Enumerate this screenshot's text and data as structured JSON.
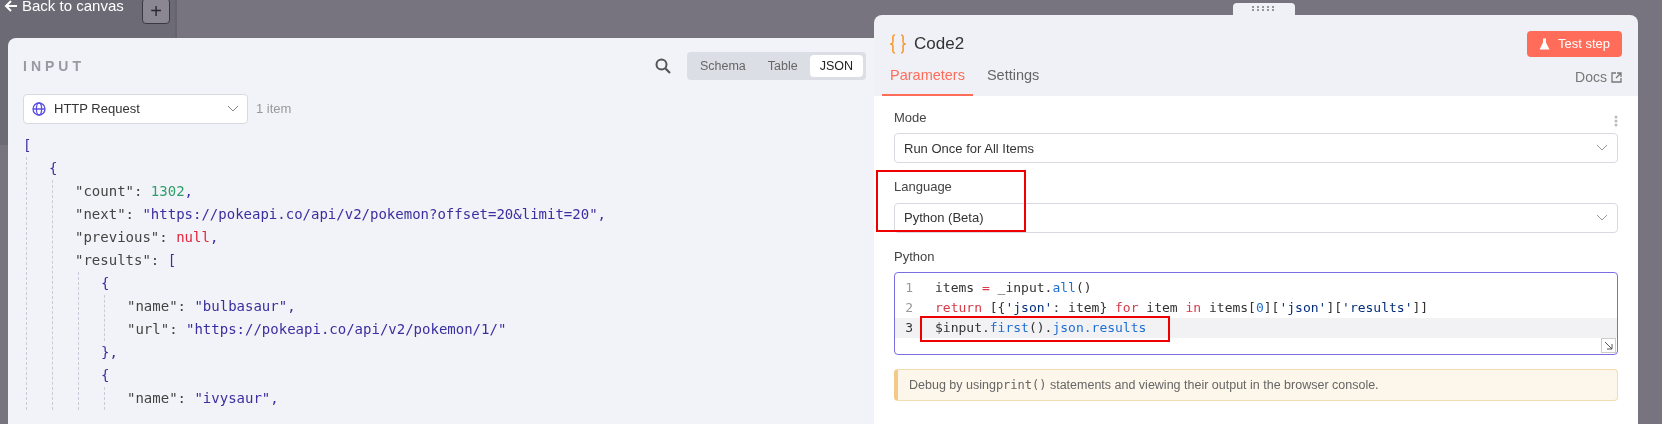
{
  "top_bar": {
    "back_link": "Back to canvas",
    "add_button": "+"
  },
  "input_panel": {
    "title": "INPUT",
    "view_tabs": [
      {
        "label": "Schema",
        "selected": false
      },
      {
        "label": "Table",
        "selected": false
      },
      {
        "label": "JSON",
        "selected": true
      }
    ],
    "source": {
      "value": "HTTP Request",
      "count": "1 item"
    },
    "json_lines": [
      {
        "tokens": [
          {
            "kind": "punct",
            "text": "["
          }
        ],
        "children": [
          {
            "tokens": [
              {
                "kind": "punct",
                "text": "{"
              }
            ],
            "children": [
              {
                "tokens": [
                  {
                    "kind": "key",
                    "text": "\"count\": "
                  },
                  {
                    "kind": "number",
                    "text": "1302"
                  },
                  {
                    "kind": "punct",
                    "text": ","
                  }
                ]
              },
              {
                "tokens": [
                  {
                    "kind": "key",
                    "text": "\"next\": "
                  },
                  {
                    "kind": "string",
                    "text": "\"https://pokeapi.co/api/v2/pokemon?offset=20&limit=20\""
                  },
                  {
                    "kind": "punct",
                    "text": ","
                  }
                ]
              },
              {
                "tokens": [
                  {
                    "kind": "key",
                    "text": "\"previous\": "
                  },
                  {
                    "kind": "null",
                    "text": "null"
                  },
                  {
                    "kind": "punct",
                    "text": ","
                  }
                ]
              },
              {
                "tokens": [
                  {
                    "kind": "key",
                    "text": "\"results\": "
                  },
                  {
                    "kind": "punct",
                    "text": "["
                  }
                ],
                "children": [
                  {
                    "tokens": [
                      {
                        "kind": "punct",
                        "text": "{"
                      }
                    ],
                    "children": [
                      {
                        "tokens": [
                          {
                            "kind": "key",
                            "text": "\"name\": "
                          },
                          {
                            "kind": "string",
                            "text": "\"bulbasaur\""
                          },
                          {
                            "kind": "punct",
                            "text": ","
                          }
                        ]
                      },
                      {
                        "tokens": [
                          {
                            "kind": "key",
                            "text": "\"url\": "
                          },
                          {
                            "kind": "string",
                            "text": "\"https://pokeapi.co/api/v2/pokemon/1/\""
                          }
                        ]
                      }
                    ]
                  },
                  {
                    "tokens": [
                      {
                        "kind": "punct",
                        "text": "},"
                      }
                    ]
                  },
                  {
                    "tokens": [
                      {
                        "kind": "punct",
                        "text": "{"
                      }
                    ],
                    "children": [
                      {
                        "tokens": [
                          {
                            "kind": "key",
                            "text": "\"name\": "
                          },
                          {
                            "kind": "string",
                            "text": "\"ivysaur\""
                          },
                          {
                            "kind": "punct",
                            "text": ","
                          }
                        ]
                      }
                    ]
                  }
                ]
              }
            ]
          }
        ]
      }
    ]
  },
  "node_panel": {
    "title": "Code2",
    "test_button": "Test step",
    "tabs": [
      {
        "label": "Parameters",
        "selected": true
      },
      {
        "label": "Settings",
        "selected": false
      }
    ],
    "docs_link": "Docs",
    "fields": [
      {
        "label": "Mode",
        "value": "Run Once for All Items",
        "highlighted": false
      },
      {
        "label": "Language",
        "value": "Python (Beta)",
        "highlighted": true
      }
    ],
    "code_label": "Python",
    "code_lines": [
      {
        "number": "1",
        "active": false,
        "highlighted": false,
        "tokens": [
          {
            "kind": "plain",
            "text": "items "
          },
          {
            "kind": "operator",
            "text": "="
          },
          {
            "kind": "plain",
            "text": " _input."
          },
          {
            "kind": "function",
            "text": "all"
          },
          {
            "kind": "plain",
            "text": "()"
          }
        ]
      },
      {
        "number": "2",
        "active": false,
        "highlighted": false,
        "tokens": [
          {
            "kind": "keyword",
            "text": "return"
          },
          {
            "kind": "plain",
            "text": " [{"
          },
          {
            "kind": "string",
            "text": "'json'"
          },
          {
            "kind": "plain",
            "text": ": item} "
          },
          {
            "kind": "keyword",
            "text": "for"
          },
          {
            "kind": "plain",
            "text": " item "
          },
          {
            "kind": "keyword",
            "text": "in"
          },
          {
            "kind": "plain",
            "text": " items["
          },
          {
            "kind": "number",
            "text": "0"
          },
          {
            "kind": "plain",
            "text": "]["
          },
          {
            "kind": "string",
            "text": "'json'"
          },
          {
            "kind": "plain",
            "text": "]["
          },
          {
            "kind": "string",
            "text": "'results'"
          },
          {
            "kind": "plain",
            "text": "]]"
          }
        ]
      },
      {
        "number": "3",
        "active": true,
        "highlighted": true,
        "tokens": [
          {
            "kind": "plain",
            "text": "$input."
          },
          {
            "kind": "function",
            "text": "first"
          },
          {
            "kind": "plain",
            "text": "()."
          },
          {
            "kind": "function",
            "text": "json.results"
          }
        ]
      }
    ],
    "notice": {
      "before": "Debug by using ",
      "code": "print()",
      "after": " statements and viewing their output in the browser console."
    }
  }
}
